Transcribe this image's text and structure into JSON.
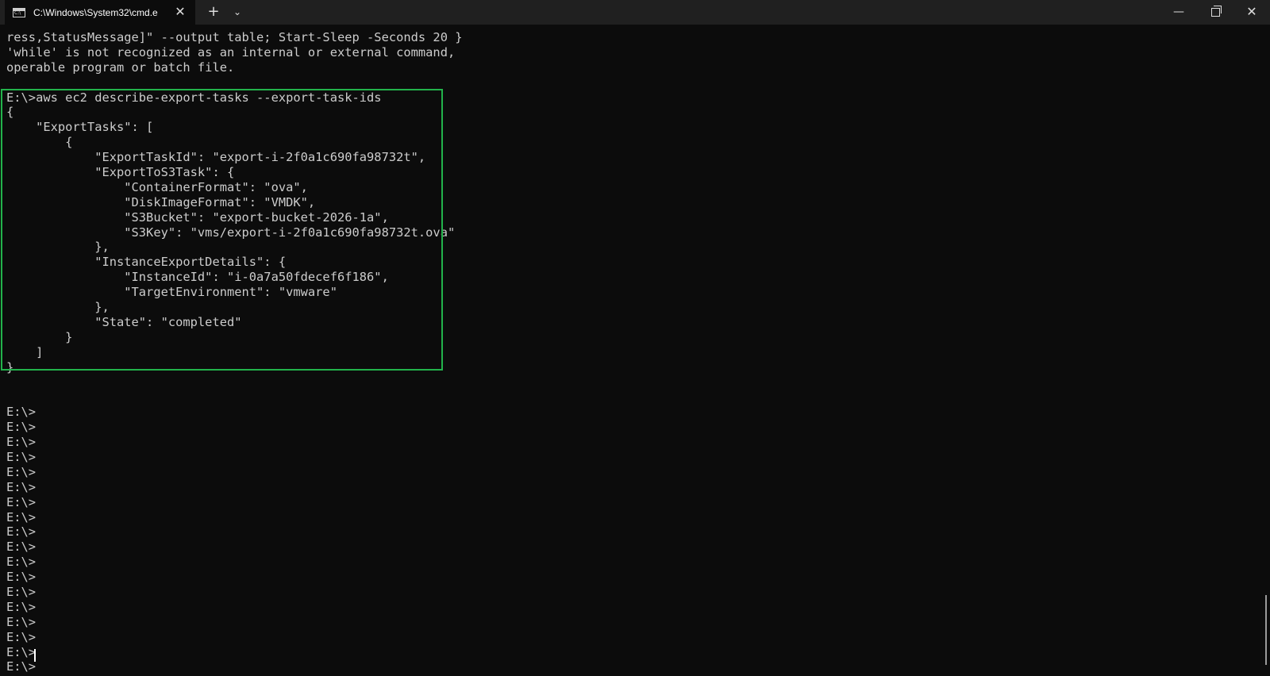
{
  "window": {
    "tab_title": "C:\\Windows\\System32\\cmd.e",
    "tab_close_glyph": "✕",
    "new_tab_glyph": "+",
    "dropdown_glyph": "⌄",
    "minimize_glyph": "—",
    "close_glyph": "✕"
  },
  "console": {
    "lines": [
      "ress,StatusMessage]\" --output table; Start-Sleep -Seconds 20 }",
      "'while' is not recognized as an internal or external command,",
      "operable program or batch file.",
      "",
      "E:\\>aws ec2 describe-export-tasks --export-task-ids",
      "{",
      "    \"ExportTasks\": [",
      "        {",
      "            \"ExportTaskId\": \"export-i-2f0a1c690fa98732t\",",
      "            \"ExportToS3Task\": {",
      "                \"ContainerFormat\": \"ova\",",
      "                \"DiskImageFormat\": \"VMDK\",",
      "                \"S3Bucket\": \"export-bucket-2026-1a\",",
      "                \"S3Key\": \"vms/export-i-2f0a1c690fa98732t.ova\"",
      "            },",
      "            \"InstanceExportDetails\": {",
      "                \"InstanceId\": \"i-0a7a50fdecef6f186\",",
      "                \"TargetEnvironment\": \"vmware\"",
      "            },",
      "            \"State\": \"completed\"",
      "        }",
      "    ]",
      "}",
      "",
      "",
      "E:\\>",
      "E:\\>",
      "E:\\>",
      "E:\\>",
      "E:\\>",
      "E:\\>",
      "E:\\>",
      "E:\\>",
      "E:\\>",
      "E:\\>",
      "E:\\>",
      "E:\\>",
      "E:\\>",
      "E:\\>",
      "E:\\>",
      "E:\\>",
      "E:\\>",
      "E:\\>"
    ]
  }
}
